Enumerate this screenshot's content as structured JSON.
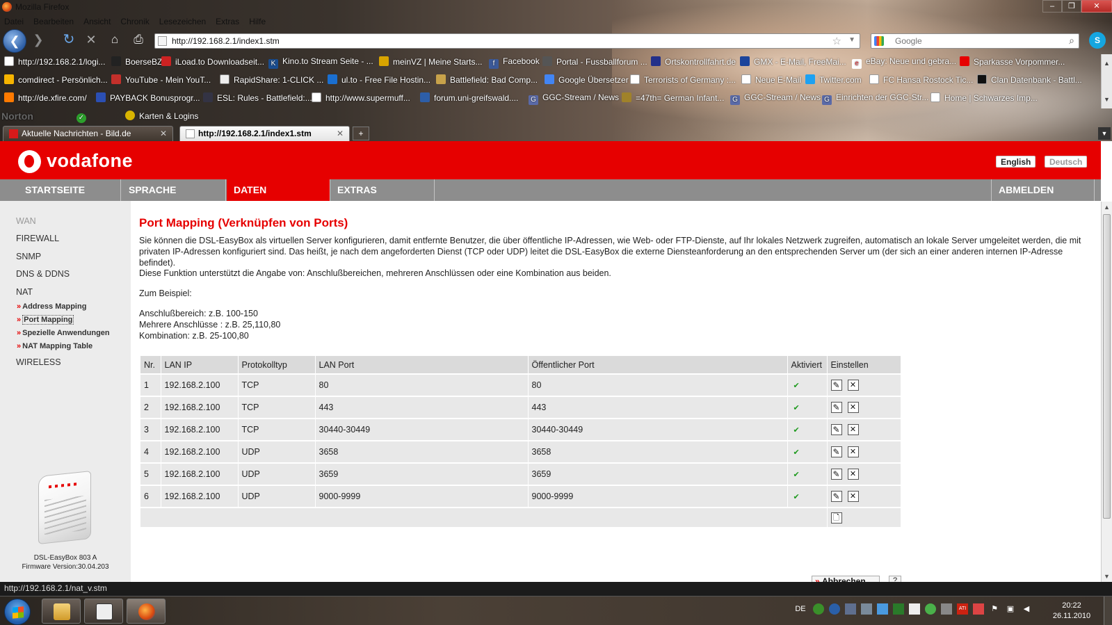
{
  "window": {
    "title": "Mozilla Firefox",
    "buttons": [
      "‒",
      "❐",
      "✕"
    ]
  },
  "menubar": [
    "Datei",
    "Bearbeiten",
    "Ansicht",
    "Chronik",
    "Lesezeichen",
    "Extras",
    "Hilfe"
  ],
  "navigation": {
    "url": "http://192.168.2.1/index1.stm",
    "search_placeholder": "Google"
  },
  "bookmarks": {
    "row1": [
      "http://192.168.2.1/logi...",
      "BoerseBZ",
      "iLoad.to Downloadseit...",
      "Kino.to Stream Seite - ...",
      "meinVZ | Meine Starts...",
      "Facebook",
      "Portal - Fussballforum ...",
      "Ortskontrollfahrt.de",
      "GMX - E-Mail, FreeMai...",
      "eBay: Neue und gebra...",
      "Sparkasse Vorpommer..."
    ],
    "row2": [
      "comdirect - Persönlich...",
      "YouTube - Mein YouT...",
      "RapidShare: 1-CLICK ...",
      "ul.to - Free File Hostin...",
      "Battlefield: Bad Comp...",
      "Google Übersetzer",
      "Terrorists of Germany :...",
      "Neue E-Mail",
      "Twitter.com",
      "FC Hansa Rostock Tic...",
      "Clan Datenbank - Battl..."
    ],
    "row3": [
      "http://de.xfire.com/",
      "PAYBACK Bonusprogr...",
      "ESL: Rules - Battlefield:...",
      "http://www.supermuff...",
      "forum.uni-greifswald....",
      "GGC-Stream / News",
      "=47th= German Infant...",
      "GGC-Stream / News",
      "Einrichten der GGC-Str...",
      "Home | Schwarzes Imp..."
    ],
    "row4": [
      "Norton",
      "Karten & Logins"
    ]
  },
  "tabs": [
    {
      "label": "Aktuelle Nachrichten - Bild.de",
      "active": false
    },
    {
      "label": "http://192.168.2.1/index1.stm",
      "active": true
    }
  ],
  "router": {
    "brand": "vodafone",
    "languages": [
      "English",
      "Deutsch"
    ],
    "nav": [
      "STARTSEITE",
      "SPRACHE",
      "DATEN",
      "EXTRAS",
      "ABMELDEN"
    ],
    "sidebar": {
      "items": [
        "WAN",
        "FIREWALL",
        "SNMP",
        "DNS & DDNS",
        "NAT"
      ],
      "sub": [
        "Address Mapping",
        "Port Mapping",
        "Spezielle Anwendungen",
        "NAT Mapping Table"
      ],
      "after": "WIRELESS"
    },
    "device": {
      "model": "DSL-EasyBox 803 A",
      "firmware": "Firmware Version:30.04.203"
    }
  },
  "content": {
    "title": "Port Mapping (Verknüpfen von Ports)",
    "description": "Sie können die DSL-EasyBox als virtuellen Server konfigurieren, damit entfernte Benutzer, die über öffentliche IP-Adressen, wie Web- oder FTP-Dienste, auf Ihr lokales Netzwerk zugreifen, automatisch an lokale Server umgeleitet werden, die mit privaten IP-Adressen konfiguriert sind. Das heißt, je nach dem angeforderten Dienst (TCP oder UDP) leitet die DSL-EasyBox die externe Diensteanforderung an den entsprechenden Server um (der sich an einer anderen internen IP-Adresse befindet).",
    "description2": "Diese Funktion unterstützt die Angabe von: Anschlußbereichen, mehreren Anschlüssen oder eine Kombination aus beiden.",
    "example_heading": "Zum Beispiel:",
    "examples": [
      "Anschlußbereich: z.B. 100-150",
      "Mehrere Anschlüsse : z.B. 25,110,80",
      "Kombination: z.B. 25-100,80"
    ]
  },
  "table": {
    "headers": [
      "Nr.",
      "LAN IP",
      "Protokolltyp",
      "LAN Port",
      "Öffentlicher Port",
      "Aktiviert",
      "Einstellen"
    ],
    "rows": [
      [
        "1",
        "192.168.2.100",
        "TCP",
        "80",
        "80"
      ],
      [
        "2",
        "192.168.2.100",
        "TCP",
        "443",
        "443"
      ],
      [
        "3",
        "192.168.2.100",
        "TCP",
        "30440-30449",
        "30440-30449"
      ],
      [
        "4",
        "192.168.2.100",
        "UDP",
        "3658",
        "3658"
      ],
      [
        "5",
        "192.168.2.100",
        "UDP",
        "3659",
        "3659"
      ],
      [
        "6",
        "192.168.2.100",
        "UDP",
        "9000-9999",
        "9000-9999"
      ]
    ],
    "check_glyph": "✔",
    "edit_glyph": "✎",
    "delete_glyph": "✕",
    "add_glyph": "🗋"
  },
  "buttons": {
    "cancel": "Abbrechen",
    "help": "?"
  },
  "statusbar": "http://192.168.2.1/nat_v.stm",
  "taskbar": {
    "lang": "DE",
    "time": "20:22",
    "date": "26.11.2010"
  },
  "colors": {
    "vodafone_red": "#e60000",
    "nav_grey": "#8d8d8d",
    "check_green": "#1d9a1d"
  }
}
